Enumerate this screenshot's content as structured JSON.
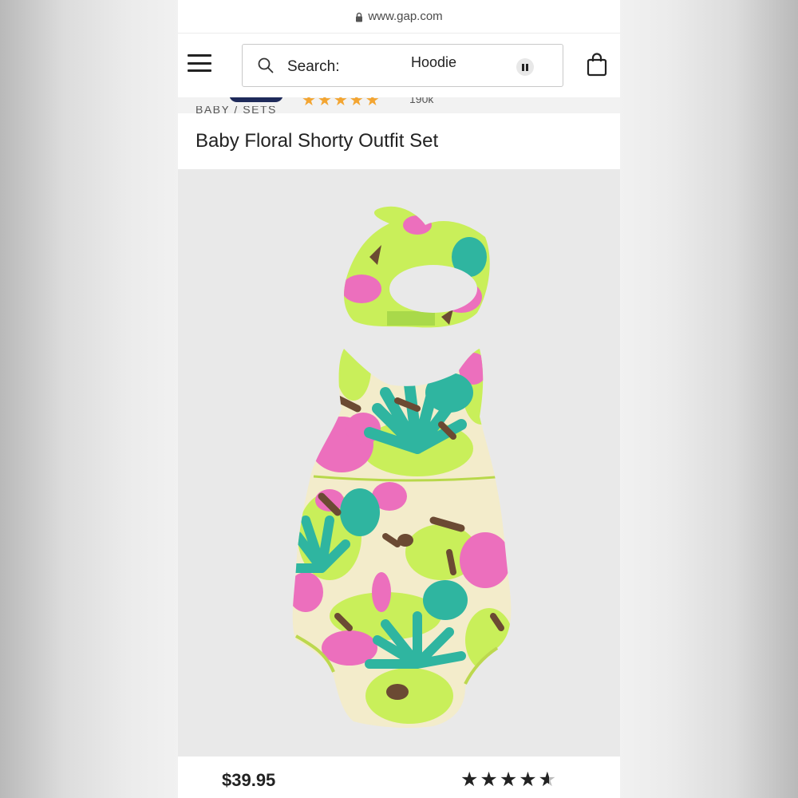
{
  "browser": {
    "url": "www.gap.com"
  },
  "header": {
    "menu_icon": "hamburger-menu-icon",
    "search": {
      "label": "Search:",
      "value": "Hoodie",
      "icon": "search-icon",
      "pause_icon": "pause-icon"
    },
    "bag_icon": "shopping-bag-icon"
  },
  "peek": {
    "stars": "★★★★★",
    "count": "190k"
  },
  "product": {
    "breadcrumb": "BABY / SETS",
    "title": "Baby Floral Shorty Outfit Set",
    "price": "$39.95",
    "rating": {
      "value": 4.5,
      "full_stars": "★★★★",
      "half_star": "★"
    }
  },
  "colors": {
    "lime": "#c9ef5a",
    "pink": "#ec6fbd",
    "teal": "#2fb5a0",
    "brown": "#6b4a33",
    "cream": "#f3eccb",
    "star_orange": "#f3a532"
  }
}
